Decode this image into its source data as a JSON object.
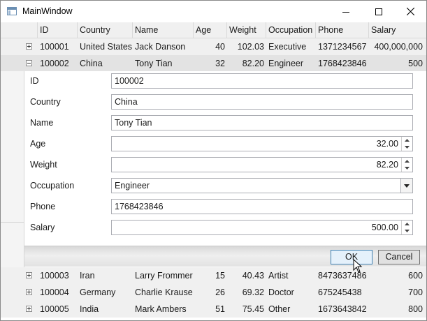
{
  "window": {
    "title": "MainWindow",
    "controls": [
      "minimize-icon",
      "maximize-icon",
      "close-icon"
    ]
  },
  "grid": {
    "columns": [
      "ID",
      "Country",
      "Name",
      "Age",
      "Weight",
      "Occupation",
      "Phone",
      "Salary"
    ],
    "rows_before": [
      {
        "id": "100001",
        "country": "United States",
        "name": "Jack Danson",
        "age": "40",
        "weight": "102.03",
        "occupation": "Executive",
        "phone": "1371234567",
        "salary": "400,000,000",
        "expanded": false
      },
      {
        "id": "100002",
        "country": "China",
        "name": "Tony Tian",
        "age": "32",
        "weight": "82.20",
        "occupation": "Engineer",
        "phone": "1768423846",
        "salary": "500",
        "expanded": true
      }
    ],
    "rows_after": [
      {
        "id": "100003",
        "country": "Iran",
        "name": "Larry Frommer",
        "age": "15",
        "weight": "40.43",
        "occupation": "Artist",
        "phone": "8473637486",
        "salary": "600",
        "expanded": false
      },
      {
        "id": "100004",
        "country": "Germany",
        "name": "Charlie Krause",
        "age": "26",
        "weight": "69.32",
        "occupation": "Doctor",
        "phone": "675245438",
        "salary": "700",
        "expanded": false
      },
      {
        "id": "100005",
        "country": "India",
        "name": "Mark Ambers",
        "age": "51",
        "weight": "75.45",
        "occupation": "Other",
        "phone": "1673643842",
        "salary": "800",
        "expanded": false
      }
    ]
  },
  "detail": {
    "fields": [
      {
        "label": "ID",
        "value": "100002",
        "kind": "text"
      },
      {
        "label": "Country",
        "value": "China",
        "kind": "text"
      },
      {
        "label": "Name",
        "value": "Tony Tian",
        "kind": "text"
      },
      {
        "label": "Age",
        "value": "32.00",
        "kind": "numeric"
      },
      {
        "label": "Weight",
        "value": "82.20",
        "kind": "numeric"
      },
      {
        "label": "Occupation",
        "value": "Engineer",
        "kind": "combo"
      },
      {
        "label": "Phone",
        "value": "1768423846",
        "kind": "text"
      },
      {
        "label": "Salary",
        "value": "500.00",
        "kind": "numeric"
      }
    ],
    "ok_label": "OK",
    "cancel_label": "Cancel"
  }
}
